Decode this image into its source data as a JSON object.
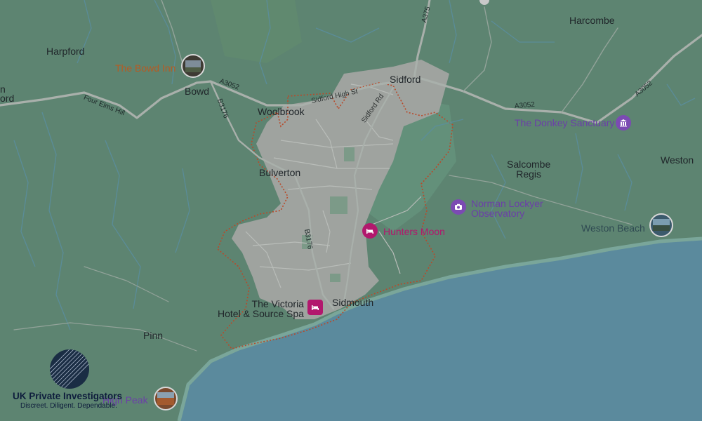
{
  "map": {
    "towns": {
      "harpford": "Harpford",
      "bowd": "Bowd",
      "woolbrook": "Woolbrook",
      "bulverton": "Bulverton",
      "sidford": "Sidford",
      "sidmouth": "Sidmouth",
      "harcombe": "Harcombe",
      "salcombe_regis_line1": "Salcombe",
      "salcombe_regis_line2": "Regis",
      "weston": "Weston",
      "pinn": "Pinn",
      "edge_left_1": "n",
      "edge_left_2": "ord"
    },
    "roads": {
      "a3052_west": "A3052",
      "a3052_mid": "A3052",
      "a3052_east": "A3052",
      "a375": "A375",
      "b3176_north": "B3176",
      "b3176_south": "B3176",
      "four_elms_hill": "Four Elms Hill",
      "sidford_high_st": "Sidford High St",
      "sidford_rd": "Sidford Rd"
    },
    "places": {
      "bowd_inn": "The Bowd Inn",
      "donkey_sanctuary": "The Donkey Sanctuary",
      "lockyer_line1": "Norman Lockyer",
      "lockyer_line2": "Observatory",
      "hunters_moon": "Hunters Moon",
      "victoria_line1": "The Victoria",
      "victoria_line2": "Hotel & Source Spa",
      "weston_beach": "Weston Beach",
      "high_peak": "High Peak"
    },
    "icons": [
      "hotel-icon",
      "museum-icon",
      "camera-icon",
      "photo-thumbnail"
    ],
    "colors": {
      "land": "#5d8471",
      "sea": "#5b8a9d",
      "urban": "#9fa39f",
      "boundary": "#b84a2a",
      "road": "#a9b0ab",
      "poi_purple": "#7b4bb3",
      "poi_pink": "#b2186d"
    }
  },
  "brand": {
    "title": "UK Private Investigators",
    "tagline": "Discreet. Diligent. Dependable."
  }
}
